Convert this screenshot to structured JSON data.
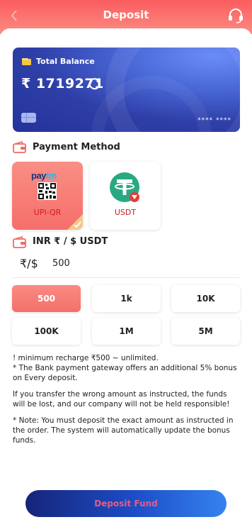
{
  "header": {
    "title": "Deposit",
    "back_icon": "chevron-left-icon",
    "support_icon": "headset-icon"
  },
  "colors": {
    "brand": "#fb5d5f",
    "card": "#2f3fa8",
    "button": "#1c4ec8",
    "button_text": "#e25d86"
  },
  "balance_card": {
    "label": "Total Balance",
    "amount": "₹ 1719271",
    "masked": "**** ****"
  },
  "payment_method": {
    "title": "Payment Method",
    "options": [
      {
        "brand": "Paytm",
        "label": "UPI-QR",
        "selected": true
      },
      {
        "label": "USDT",
        "selected": false
      }
    ]
  },
  "amount": {
    "title": "INR ₹ / $ USDT",
    "currency": "₹/$",
    "value": "500"
  },
  "presets": [
    "500",
    "1k",
    "10K",
    "100K",
    "1M",
    "5M"
  ],
  "notes": {
    "line1": "! minimum recharge ₹500 ~ unlimited.",
    "line2": "* The Bank payment gateway offers an additional 5% bonus on Every deposit.",
    "warn": "If you transfer the wrong amount as instructed, the funds will be lost, and our company will not be held responsible!",
    "note": "* Note: You must deposit the exact amount as instructed in the order. The system will automatically update the bonus funds."
  },
  "deposit_button": "Deposit Fund"
}
